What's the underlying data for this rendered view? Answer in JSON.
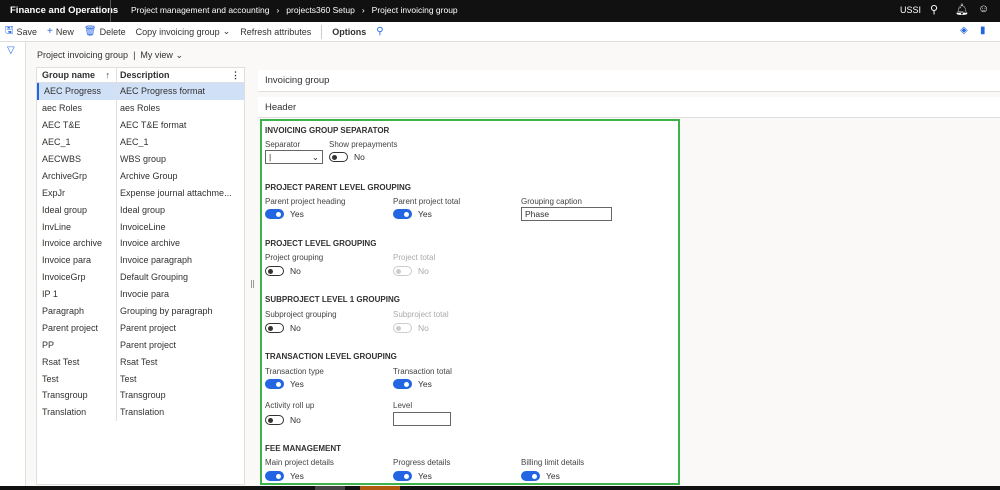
{
  "app_title": "Finance and Operations",
  "breadcrumb": [
    "Project management and accounting",
    "projects360 Setup",
    "Project invoicing group"
  ],
  "user": "USSI",
  "toolbar": {
    "save": "Save",
    "new": "New",
    "delete": "Delete",
    "copy": "Copy invoicing group",
    "refresh": "Refresh attributes",
    "options": "Options"
  },
  "view": {
    "title": "Project invoicing group",
    "separator": "|",
    "view_name": "My view"
  },
  "grid": {
    "headers": [
      "Group name",
      "Description"
    ],
    "rows": [
      [
        "AEC Progress",
        "AEC Progress format"
      ],
      [
        "aec Roles",
        "aes Roles"
      ],
      [
        "AEC T&E",
        "AEC T&E format"
      ],
      [
        "AEC_1",
        "AEC_1"
      ],
      [
        "AECWBS",
        "WBS group"
      ],
      [
        "ArchiveGrp",
        "Archive Group"
      ],
      [
        "ExpJr",
        "Expense journal attachme..."
      ],
      [
        "Ideal group",
        "Ideal group"
      ],
      [
        "InvLine",
        "InvoiceLine"
      ],
      [
        "Invoice archive",
        "Invoice archive"
      ],
      [
        "Invoice para",
        "Invoice paragraph"
      ],
      [
        "InvoiceGrp",
        "Default Grouping"
      ],
      [
        "IP 1",
        "Invocie para"
      ],
      [
        "Paragraph",
        "Grouping by paragraph"
      ],
      [
        "Parent project",
        "Parent project"
      ],
      [
        "PP",
        "Parent project"
      ],
      [
        "Rsat Test",
        "Rsat Test"
      ],
      [
        "Test",
        "Test"
      ],
      [
        "Transgroup",
        "Transgroup"
      ],
      [
        "Translation",
        "Translation"
      ]
    ]
  },
  "panel": {
    "invoicing_group": "Invoicing group",
    "header": "Header"
  },
  "form": {
    "s1": "INVOICING GROUP SEPARATOR",
    "separator_label": "Separator",
    "separator_value": "|",
    "show_prepayments": "Show prepayments",
    "show_prepayments_val": "No",
    "s2": "PROJECT PARENT LEVEL GROUPING",
    "parent_heading": "Parent project heading",
    "parent_heading_val": "Yes",
    "parent_total": "Parent project total",
    "parent_total_val": "Yes",
    "grouping_caption": "Grouping caption",
    "grouping_caption_val": "Phase",
    "s3": "PROJECT LEVEL GROUPING",
    "project_grouping": "Project grouping",
    "project_grouping_val": "No",
    "project_total": "Project total",
    "project_total_val": "No",
    "s4": "SUBPROJECT LEVEL 1 GROUPING",
    "sub_grouping": "Subproject grouping",
    "sub_grouping_val": "No",
    "sub_total": "Subproject total",
    "sub_total_val": "No",
    "s5": "TRANSACTION LEVEL GROUPING",
    "trans_type": "Transaction type",
    "trans_type_val": "Yes",
    "trans_total": "Transaction total",
    "trans_total_val": "Yes",
    "activity": "Activity roll up",
    "activity_val": "No",
    "level": "Level",
    "level_val": "",
    "s6": "FEE MANAGEMENT",
    "main_details": "Main project details",
    "main_details_val": "Yes",
    "progress_details": "Progress details",
    "progress_details_val": "Yes",
    "billing_details": "Billing limit details",
    "billing_details_val": "Yes"
  }
}
